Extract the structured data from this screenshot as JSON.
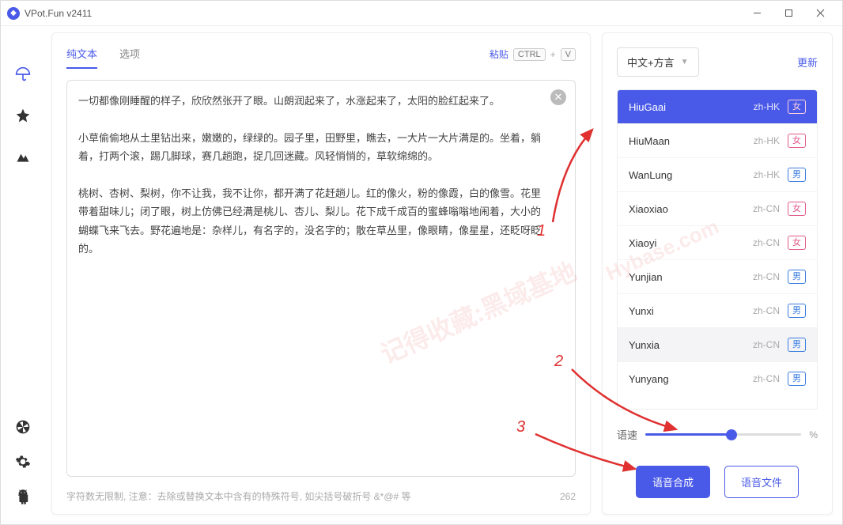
{
  "window": {
    "title": "VPot.Fun v2411"
  },
  "tabs": {
    "plain": "纯文本",
    "options": "选项"
  },
  "paste": {
    "label": "粘贴",
    "kbd1": "CTRL",
    "kbd_plus": "+",
    "kbd2": "V"
  },
  "editor": {
    "text": "一切都像刚睡醒的样子，欣欣然张开了眼。山朗润起来了，水涨起来了，太阳的脸红起来了。\n\n小草偷偷地从土里钻出来，嫩嫩的，绿绿的。园子里，田野里，瞧去，一大片一大片满是的。坐着，躺着，打两个滚，踢几脚球，赛几趟跑，捉几回迷藏。风轻悄悄的，草软绵绵的。\n\n桃树、杏树、梨树，你不让我，我不让你，都开满了花赶趟儿。红的像火，粉的像霞，白的像雪。花里带着甜味儿；闭了眼，树上仿佛已经满是桃儿、杏儿、梨儿。花下成千成百的蜜蜂嗡嗡地闹着，大小的蝴蝶飞来飞去。野花遍地是：杂样儿，有名字的，没名字的；散在草丛里，像眼睛，像星星，还眨呀眨的。",
    "hint": "字符数无限制, 注意：去除或替换文本中含有的特殊符号, 如尖括号破折号 &*@# 等",
    "count": "262"
  },
  "lang": {
    "label": "中文+方言",
    "refresh": "更新"
  },
  "voices": [
    {
      "name": "HiuGaai",
      "locale": "zh-HK",
      "gender": "女",
      "g": "f",
      "sel": true
    },
    {
      "name": "HiuMaan",
      "locale": "zh-HK",
      "gender": "女",
      "g": "f"
    },
    {
      "name": "WanLung",
      "locale": "zh-HK",
      "gender": "男",
      "g": "m"
    },
    {
      "name": "Xiaoxiao",
      "locale": "zh-CN",
      "gender": "女",
      "g": "f"
    },
    {
      "name": "Xiaoyi",
      "locale": "zh-CN",
      "gender": "女",
      "g": "f"
    },
    {
      "name": "Yunjian",
      "locale": "zh-CN",
      "gender": "男",
      "g": "m"
    },
    {
      "name": "Yunxi",
      "locale": "zh-CN",
      "gender": "男",
      "g": "m"
    },
    {
      "name": "Yunxia",
      "locale": "zh-CN",
      "gender": "男",
      "g": "m",
      "hover": true
    },
    {
      "name": "Yunyang",
      "locale": "zh-CN",
      "gender": "男",
      "g": "m"
    }
  ],
  "speed": {
    "label": "语速",
    "pct_suffix": "%",
    "value": 55
  },
  "buttons": {
    "synth": "语音合成",
    "file": "语音文件"
  },
  "anno": {
    "n1": "1",
    "n2": "2",
    "n3": "3"
  },
  "watermark": {
    "a": "记得收藏:黑域基地",
    "b": "Hybase.com"
  }
}
